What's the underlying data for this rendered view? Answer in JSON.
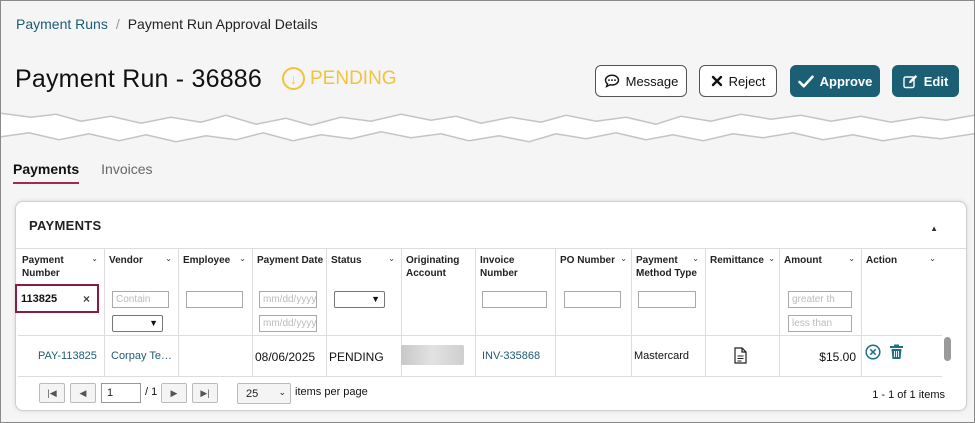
{
  "breadcrumb": {
    "parent": "Payment Runs",
    "separator": "/",
    "current": "Payment Run Approval Details"
  },
  "header": {
    "title": "Payment Run - 36886",
    "status": "PENDING"
  },
  "actions": {
    "message": "Message",
    "reject": "Reject",
    "approve": "Approve",
    "edit": "Edit"
  },
  "tabs": [
    {
      "label": "Payments",
      "active": true
    },
    {
      "label": "Invoices",
      "active": false
    }
  ],
  "panel": {
    "title": "PAYMENTS"
  },
  "columns": [
    {
      "label": "Payment Number"
    },
    {
      "label": "Vendor"
    },
    {
      "label": "Employee"
    },
    {
      "label": "Payment Date"
    },
    {
      "label": "Status"
    },
    {
      "label": "Originating Account"
    },
    {
      "label": "Invoice Number"
    },
    {
      "label": "PO Number"
    },
    {
      "label": "Payment Method Type"
    },
    {
      "label": "Remittance"
    },
    {
      "label": "Amount"
    },
    {
      "label": "Action"
    }
  ],
  "filters": {
    "payment_number": "113825",
    "vendor_placeholder": "Contain",
    "date_from_placeholder": "mm/dd/yyyy",
    "date_to_placeholder": "mm/dd/yyyy",
    "amount_min_placeholder": "greater th",
    "amount_max_placeholder": "less than"
  },
  "rows": [
    {
      "payment_number": "PAY-113825",
      "vendor": "Corpay Te…",
      "employee": "",
      "payment_date": "08/06/2025",
      "status": "PENDING",
      "invoice_number": "INV-335868",
      "po_number": "",
      "payment_method_type": "Mastercard",
      "amount": "$15.00"
    }
  ],
  "pager": {
    "page": "1",
    "total_pages": "/ 1",
    "page_size": "25",
    "items_per_page_label": "items per page",
    "summary": "1 - 1 of 1 items"
  },
  "colors": {
    "brand": "#1b5f74",
    "pending": "#f0c43c",
    "tab_underline": "#9e2a55",
    "filter_highlight": "#8b1c3e",
    "link": "#1e5c73"
  }
}
